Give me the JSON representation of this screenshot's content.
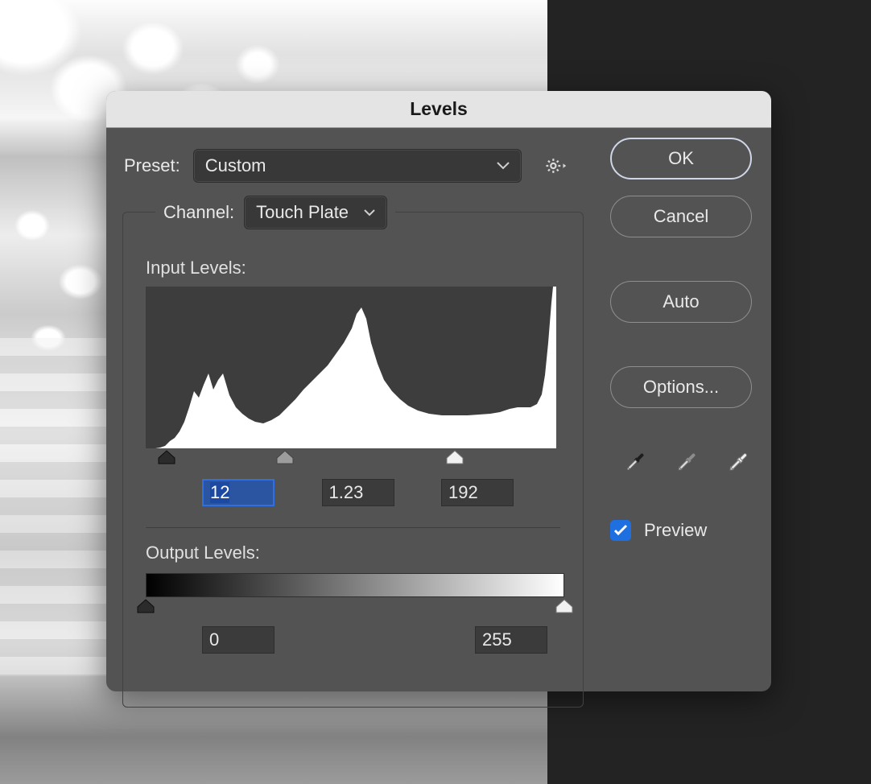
{
  "dialog": {
    "title": "Levels",
    "preset_label": "Preset:",
    "preset_value": "Custom",
    "channel_label": "Channel:",
    "channel_value": "Touch Plate",
    "input_levels_label": "Input Levels:",
    "input_shadow": "12",
    "input_mid": "1.23",
    "input_highlight": "192",
    "output_levels_label": "Output Levels:",
    "output_shadow": "0",
    "output_highlight": "255",
    "buttons": {
      "ok": "OK",
      "cancel": "Cancel",
      "auto": "Auto",
      "options": "Options..."
    },
    "preview_label": "Preview",
    "preview_checked": true,
    "slider_positions": {
      "shadow_pct": 5.0,
      "mid_pct": 34.0,
      "highlight_pct": 75.3
    },
    "output_positions": {
      "shadow_pct": 0,
      "highlight_pct": 100
    }
  },
  "colors": {
    "accent": "#1e6fe0",
    "dialog_bg": "#535353",
    "titlebar_bg": "#e4e4e4"
  }
}
